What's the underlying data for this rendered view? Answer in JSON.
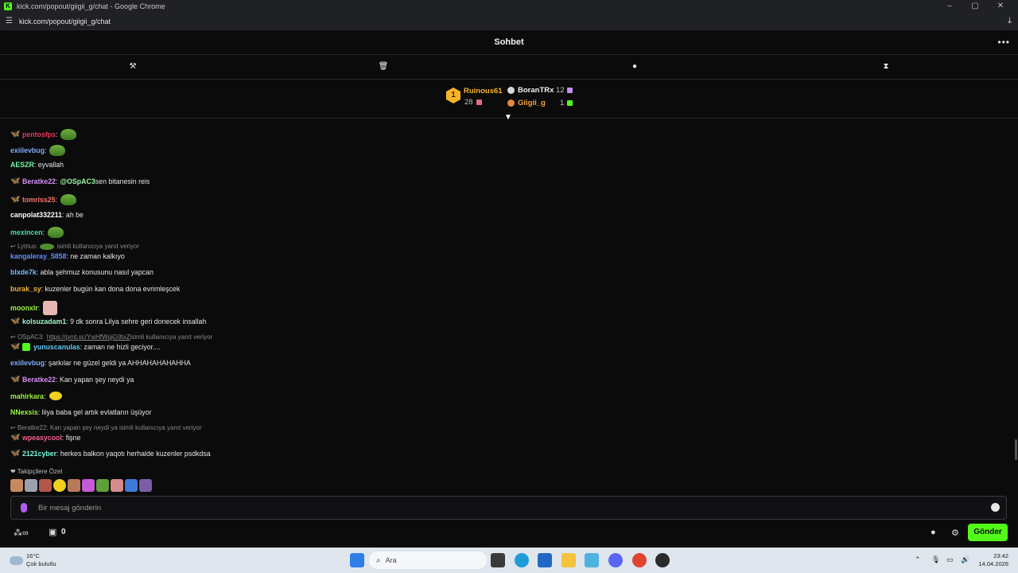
{
  "browser": {
    "window_title": "kick.com/popout/giigii_g/chat - Google Chrome",
    "url": "kick.com/popout/giigii_g/chat",
    "minimize": "–",
    "maximize": "▢",
    "close": "✕"
  },
  "chat": {
    "title": "Sohbet",
    "more_label": "•••"
  },
  "leaderboard": {
    "rank": "1",
    "first": {
      "name": "Ruinous61",
      "count": "28"
    },
    "second": {
      "name": "BoranTRx",
      "count": "12"
    },
    "third": {
      "name": "Giigii_g",
      "count": "1"
    }
  },
  "messages": [
    {
      "badge": "fly",
      "user": "pentosfps",
      "user_color": "#e33a55",
      "text": ":",
      "emote": "frog"
    },
    {
      "badge": "",
      "user": "exiilevbug",
      "user_color": "#7fa9f5",
      "text": ":",
      "emote": "frog"
    },
    {
      "badge": "",
      "user": "AESZR",
      "user_color": "#73f8a9",
      "text": ": eyvallah",
      "emote": ""
    },
    {
      "badge": "fly",
      "user": "Beratke22",
      "user_color": "#d58cf5",
      "text": ":",
      "mention": "@OSpAC3",
      "tail": " sen bitanesin reis",
      "emote": ""
    },
    {
      "badge": "fly-orange",
      "user": "tomriss25",
      "user_color": "#f5736b",
      "text": ":",
      "emote": "frog"
    },
    {
      "badge": "",
      "user": "canpolat332211",
      "user_color": "#ffffff",
      "text": ": ah be",
      "emote": ""
    },
    {
      "badge": "",
      "user": "mexincen",
      "user_color": "#3fe0a0",
      "text": ":",
      "emote": "frog"
    },
    {
      "badge": "",
      "user": "kangaleray_5858",
      "user_color": "#5f8ff5",
      "text": ": ne zaman kalkıyo",
      "emote": ""
    },
    {
      "badge": "",
      "user": "blxde7k",
      "user_color": "#7fb8f5",
      "text": ": abla şehmuz konusunu nasıl yapcan",
      "emote": ""
    },
    {
      "badge": "",
      "user": "burak_sy",
      "user_color": "#f5b23d",
      "text": ": kuzenler bugün kan dona dona evrimleşcek",
      "emote": ""
    },
    {
      "badge": "",
      "user": "moonxlr",
      "user_color": "#9ef53d",
      "text": ":",
      "emote": "cat"
    },
    {
      "badge": "fly",
      "user": "kolsuzadam1",
      "user_color": "#9ef5c3",
      "text": ": 9 dk sonra Lilya sehre geri donecek insallah",
      "emote": ""
    },
    {
      "badge": "fly+sq",
      "user": "yunuscanulas",
      "user_color": "#5fc8f5",
      "text": ": zaman ne hizli geciyor....",
      "emote": ""
    },
    {
      "badge": "",
      "user": "exiilevbug",
      "user_color": "#7fa9f5",
      "text": ": şarkılar ne güzel geldi ya AHHAHAHAHAHHA",
      "emote": ""
    },
    {
      "badge": "fly",
      "user": "Beratke22",
      "user_color": "#d58cf5",
      "text": ": Kan yapan şey neydi ya",
      "emote": ""
    },
    {
      "badge": "",
      "user": "mahirkara",
      "user_color": "#9ef53d",
      "text": ":",
      "emote": "yellow"
    },
    {
      "badge": "",
      "user": "NNexsis",
      "user_color": "#9ef53d",
      "text": ": liiya baba gel artık evlatların üşüyor",
      "emote": ""
    },
    {
      "badge": "fly",
      "user": "wpeasycool",
      "user_color": "#f55f8f",
      "text": ": fişne",
      "emote": ""
    },
    {
      "badge": "fly",
      "user": "2121cyber",
      "user_color": "#73f8d8",
      "text": ": herkes balkon yaqotı herhalde kuzenler psdkdsa",
      "emote": ""
    }
  ],
  "replies": [
    {
      "prefix": "Lytrius:",
      "frog": true,
      "link": "",
      "suffix": "isimli kullanıcıya yanıt veriyor"
    },
    {
      "prefix": "OSpAC3:",
      "frog": false,
      "link": "https://prnt.sc/YwHfWqjG9txZ",
      "suffix": " isimli kullanıcıya yanıt veriyor"
    },
    {
      "prefix": "Beratke22: Kan yapan şey neydi ya isimli kullanıcıya yanıt veriyor",
      "frog": false,
      "link": "",
      "suffix": ""
    }
  ],
  "followers": {
    "label": "Takipçilere Özel"
  },
  "input": {
    "placeholder": "Bir mesaj gönderin"
  },
  "bottom": {
    "points": "0",
    "send_label": "Gönder"
  },
  "taskbar": {
    "temp": "16°C",
    "weather": "Çok bulutlu",
    "search": "Ara",
    "time": "23:42",
    "date": "14.04.2026"
  }
}
